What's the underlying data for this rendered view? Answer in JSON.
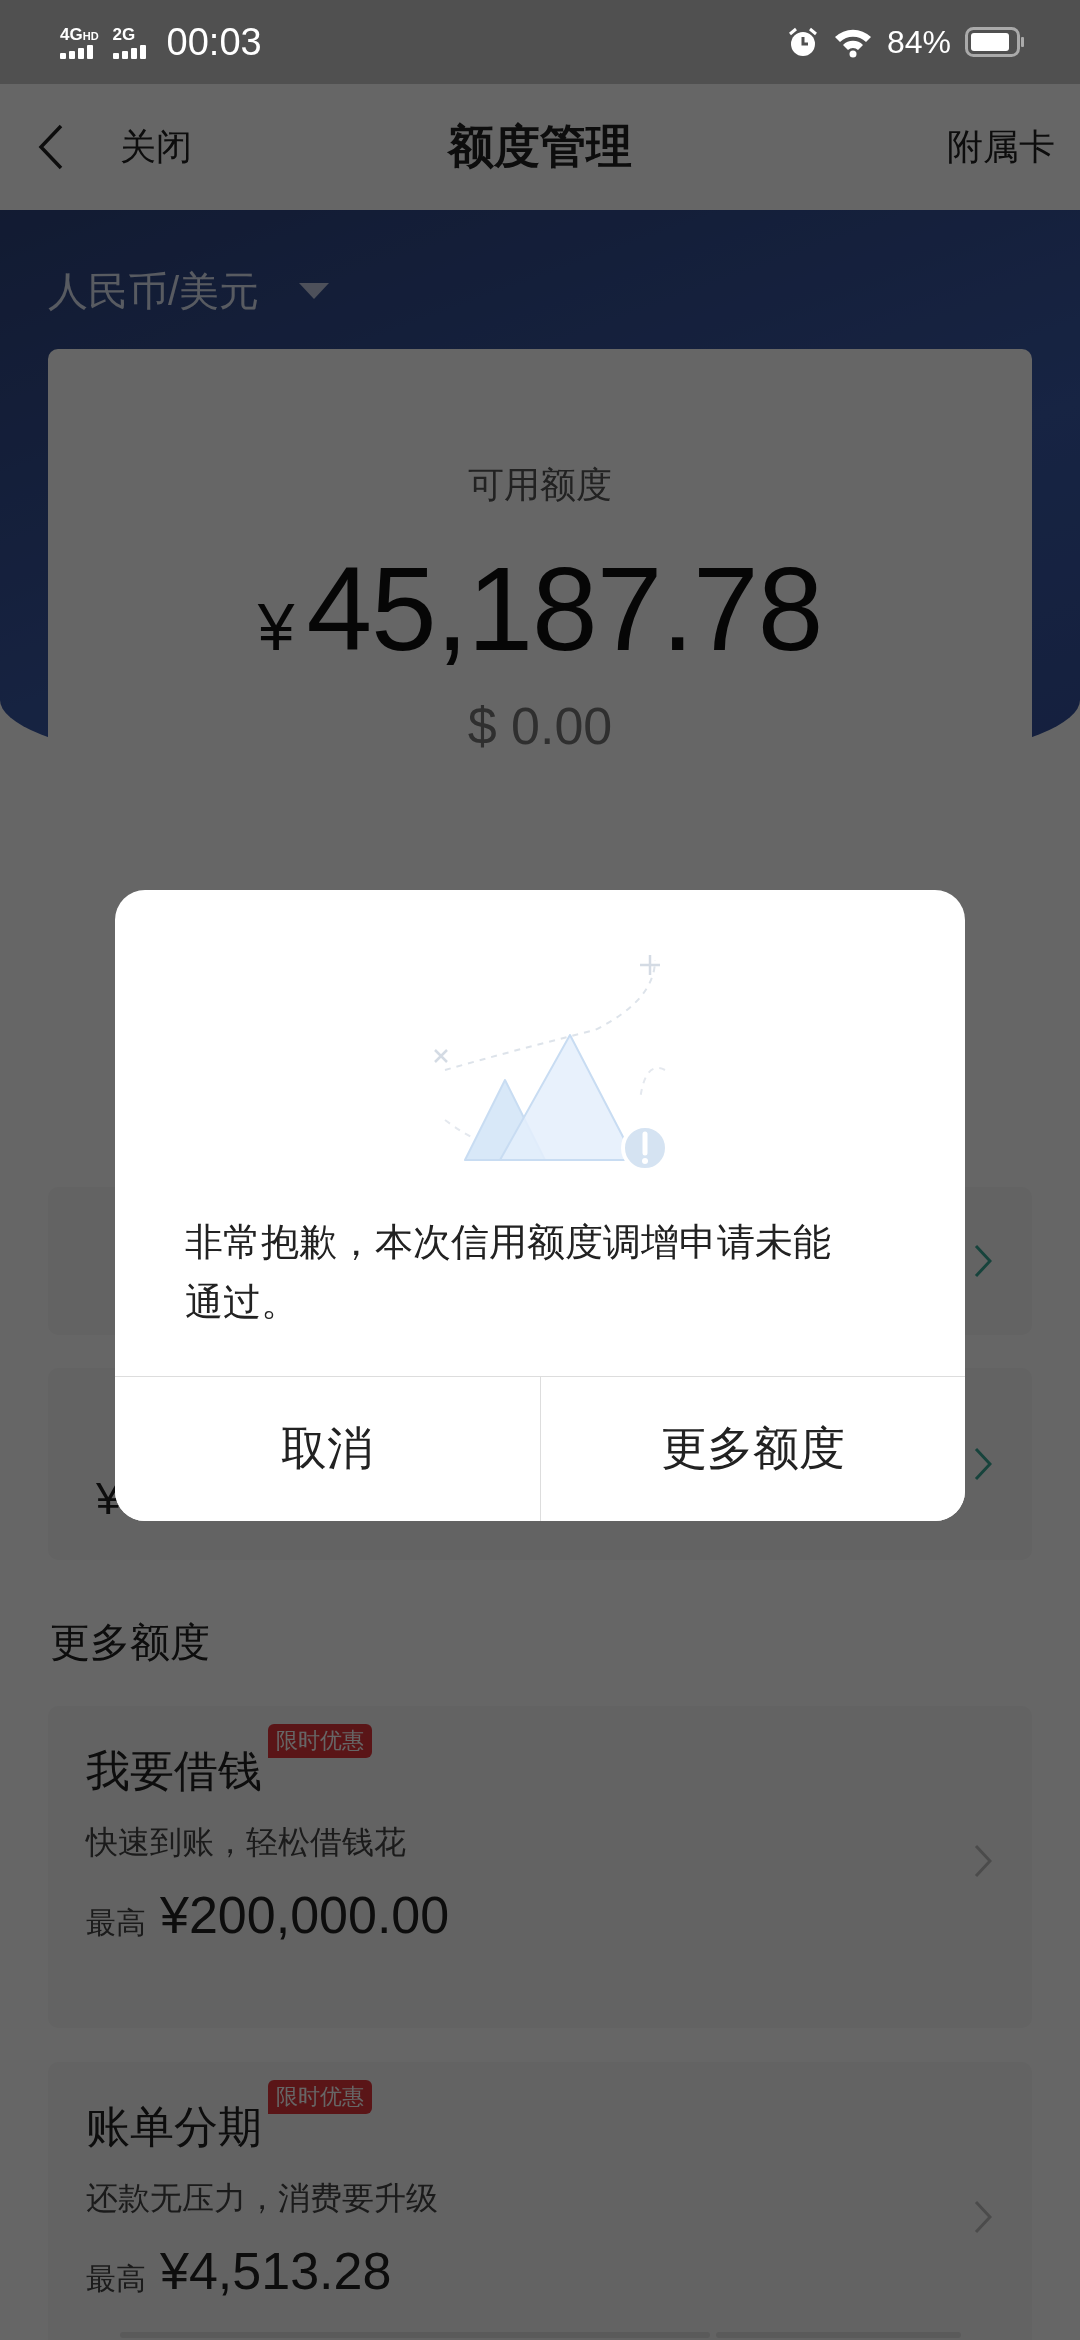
{
  "status_bar": {
    "networks": [
      {
        "label": "4G",
        "extra": "HD"
      },
      {
        "label": "2G"
      }
    ],
    "time": "00:03",
    "battery": "84%"
  },
  "nav": {
    "close": "关闭",
    "title": "额度管理",
    "right": "附属卡"
  },
  "currency_selector": "人民币/美元",
  "available": {
    "label": "可用额度",
    "currency_symbol": "¥",
    "amount": "45,187.78",
    "usd": "$ 0.00"
  },
  "hidden_rows": [
    {
      "kind": "plain"
    },
    {
      "kind": "amount",
      "amount": "¥"
    }
  ],
  "section_title": "更多额度",
  "offers": [
    {
      "title": "我要借钱",
      "badge": "限时优惠",
      "subtitle": "快速到账，轻松借钱花",
      "prefix": "最高",
      "amount": "¥200,000.00"
    },
    {
      "title": "账单分期",
      "badge": "限时优惠",
      "subtitle": "还款无压力，消费要升级",
      "prefix": "最高",
      "amount": "¥4,513.28"
    }
  ],
  "dialog": {
    "message": "非常抱歉，本次信用额度调增申请未能通过。",
    "buttons": [
      "取消",
      "更多额度"
    ]
  }
}
